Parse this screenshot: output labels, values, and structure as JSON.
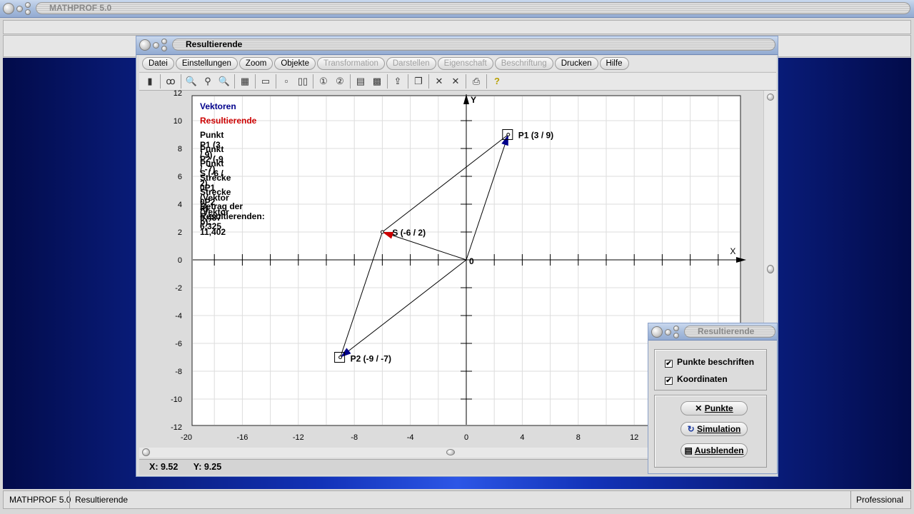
{
  "app": {
    "title": "MATHPROF 5.0"
  },
  "window": {
    "title": "Resultierende",
    "menu": [
      {
        "label": "Datei",
        "enabled": true
      },
      {
        "label": "Einstellungen",
        "enabled": true
      },
      {
        "label": "Zoom",
        "enabled": true
      },
      {
        "label": "Objekte",
        "enabled": true
      },
      {
        "label": "Transformation",
        "enabled": false
      },
      {
        "label": "Darstellen",
        "enabled": false
      },
      {
        "label": "Eigenschaft",
        "enabled": false
      },
      {
        "label": "Beschriftung",
        "enabled": false
      },
      {
        "label": "Drucken",
        "enabled": true
      },
      {
        "label": "Hilfe",
        "enabled": true
      }
    ],
    "toolbar": [
      "window-icon",
      "glasses-icon",
      "zoom-out-icon",
      "zoom-icon",
      "zoom-in-icon",
      "properties-icon",
      "layout-icon",
      "single-icon",
      "double-icon",
      "circle-1-icon",
      "circle-2-icon",
      "table-icon",
      "image-icon",
      "export-icon",
      "copy-icon",
      "cross-icon",
      "cross-double-icon",
      "print-icon",
      "help-icon"
    ],
    "status": {
      "x": "X: 9.52",
      "y": "Y: 9.25"
    }
  },
  "legend": {
    "vektoren": "Vektoren",
    "resultierende": "Resultierende",
    "lines": [
      "Punkt P1 (3 / 9)",
      "Punkt P2 (-9 / -7)",
      "Punkt S (-6 / 2)",
      "Strecke 0P1 (Vektor a): 9,487",
      "Strecke 0P2 (Vektor b): 11,402",
      "Betrag der Resultierenden: 6,325"
    ],
    "colors": {
      "vektoren": "#00008b",
      "resultierende": "#cc0000"
    }
  },
  "chart_data": {
    "type": "scatter",
    "xlim": [
      -20,
      20
    ],
    "ylim": [
      -12,
      12
    ],
    "grid": true,
    "xlabel": "X",
    "ylabel": "Y",
    "xticks": [
      "-20",
      "-16",
      "-12",
      "-8",
      "-4",
      "0",
      "4",
      "8",
      "12"
    ],
    "xtick_values": [
      -20,
      -16,
      -12,
      -8,
      -4,
      0,
      4,
      8,
      12
    ],
    "yticks": [
      "12",
      "10",
      "8",
      "6",
      "4",
      "2",
      "0",
      "-2",
      "-4",
      "-6",
      "-8",
      "-10",
      "-12"
    ],
    "ytick_values": [
      12,
      10,
      8,
      6,
      4,
      2,
      0,
      -2,
      -4,
      -6,
      -8,
      -10,
      -12
    ],
    "origin_label": "0",
    "points": [
      {
        "name": "P1",
        "x": 3,
        "y": 9,
        "label": "P1 (3 / 9)"
      },
      {
        "name": "P2",
        "x": -9,
        "y": -7,
        "label": "P2 (-9 / -7)"
      },
      {
        "name": "S",
        "x": -6,
        "y": 2,
        "label": "S (-6 / 2)"
      }
    ]
  },
  "dialog": {
    "title": "Resultierende",
    "checkboxes": [
      {
        "label": "Punkte beschriften",
        "checked": true
      },
      {
        "label": "Koordinaten",
        "checked": true
      }
    ],
    "buttons": [
      "Punkte",
      "Simulation",
      "Ausblenden"
    ]
  },
  "statusbar": {
    "app": "MATHPROF 5.0",
    "doc": "Resultierende",
    "edition": "Professional"
  }
}
